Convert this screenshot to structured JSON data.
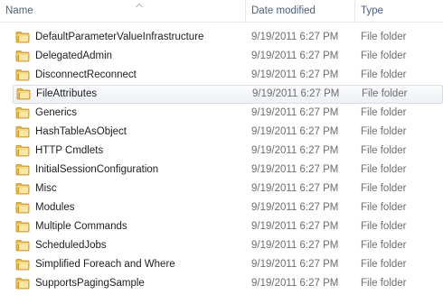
{
  "columns": {
    "name": "Name",
    "date": "Date modified",
    "type": "Type"
  },
  "icons": {
    "folder": "folder-icon",
    "sort": "sort-ascending-icon"
  },
  "colors": {
    "folder_light": "#f7dc8a",
    "folder_dark": "#d9a53a",
    "header_text": "#4c607a",
    "meta_text": "#6d6d6d"
  },
  "hovered_row": "FileAttributes",
  "files": [
    {
      "name": "DefaultParameterValueInfrastructure",
      "date": "9/19/2011 6:27 PM",
      "type": "File folder"
    },
    {
      "name": "DelegatedAdmin",
      "date": "9/19/2011 6:27 PM",
      "type": "File folder"
    },
    {
      "name": "DisconnectReconnect",
      "date": "9/19/2011 6:27 PM",
      "type": "File folder"
    },
    {
      "name": "FileAttributes",
      "date": "9/19/2011 6:27 PM",
      "type": "File folder"
    },
    {
      "name": "Generics",
      "date": "9/19/2011 6:27 PM",
      "type": "File folder"
    },
    {
      "name": "HashTableAsObject",
      "date": "9/19/2011 6:27 PM",
      "type": "File folder"
    },
    {
      "name": "HTTP Cmdlets",
      "date": "9/19/2011 6:27 PM",
      "type": "File folder"
    },
    {
      "name": "InitialSessionConfiguration",
      "date": "9/19/2011 6:27 PM",
      "type": "File folder"
    },
    {
      "name": "Misc",
      "date": "9/19/2011 6:27 PM",
      "type": "File folder"
    },
    {
      "name": "Modules",
      "date": "9/19/2011 6:27 PM",
      "type": "File folder"
    },
    {
      "name": "Multiple Commands",
      "date": "9/19/2011 6:27 PM",
      "type": "File folder"
    },
    {
      "name": "ScheduledJobs",
      "date": "9/19/2011 6:27 PM",
      "type": "File folder"
    },
    {
      "name": "Simplified Foreach and Where",
      "date": "9/19/2011 6:27 PM",
      "type": "File folder"
    },
    {
      "name": "SupportsPagingSample",
      "date": "9/19/2011 6:27 PM",
      "type": "File folder"
    }
  ]
}
